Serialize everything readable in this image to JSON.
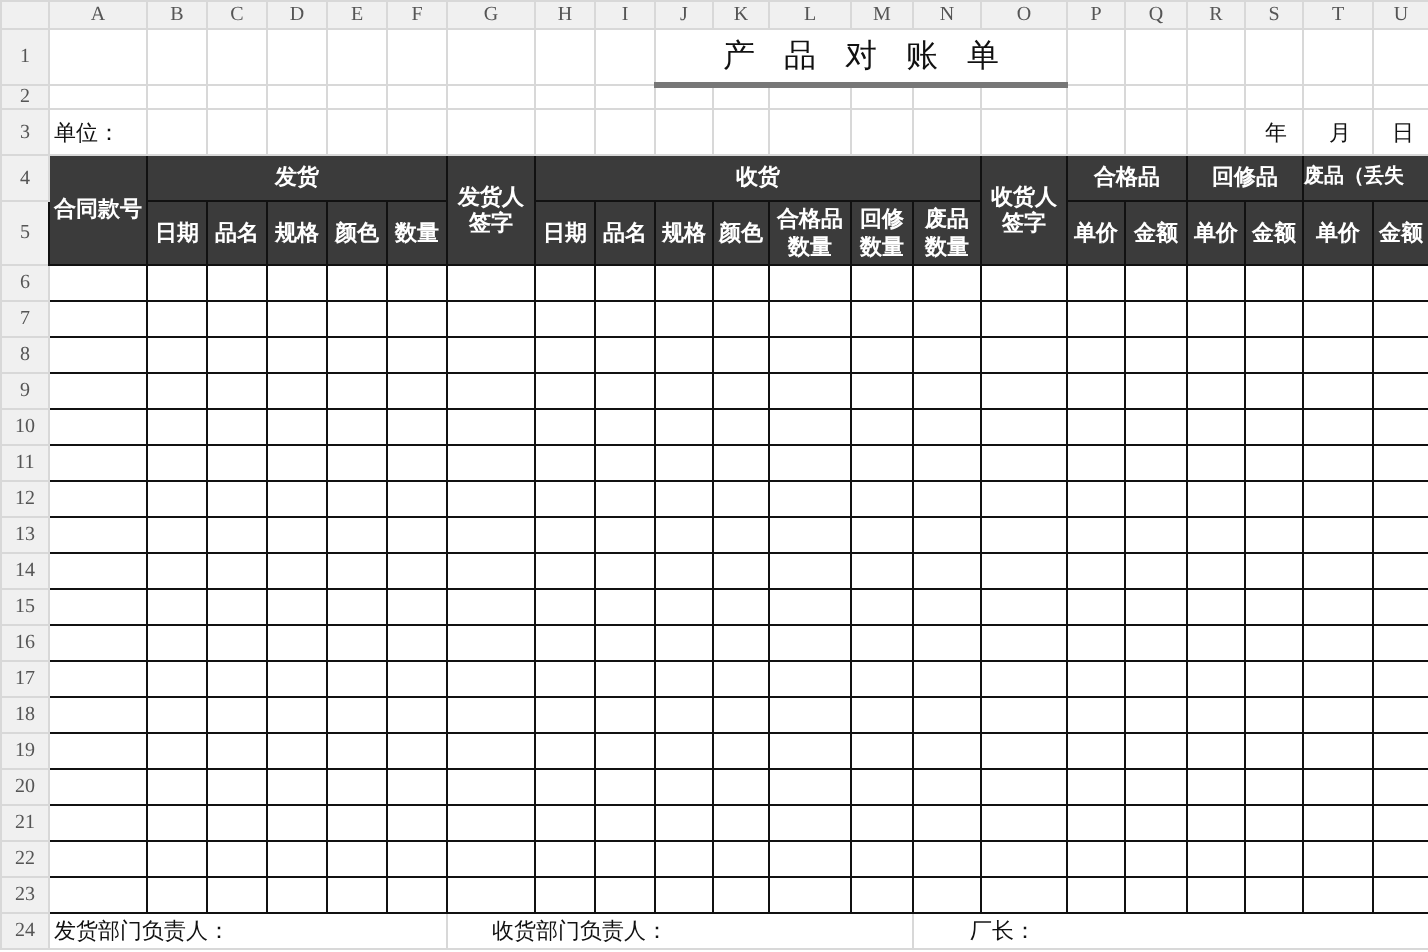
{
  "column_headers": [
    "A",
    "B",
    "C",
    "D",
    "E",
    "F",
    "G",
    "H",
    "I",
    "J",
    "K",
    "L",
    "M",
    "N",
    "O",
    "P",
    "Q",
    "R",
    "S",
    "T",
    "U"
  ],
  "row_numbers": [
    "1",
    "2",
    "3",
    "4",
    "5",
    "6",
    "7",
    "8",
    "9",
    "10",
    "11",
    "12",
    "13",
    "14",
    "15",
    "16",
    "17",
    "18",
    "19",
    "20",
    "21",
    "22",
    "23",
    "24"
  ],
  "title": "产品对账单",
  "unit_label": "单位：",
  "date_labels": [
    "年",
    "月",
    "日"
  ],
  "header": {
    "contract_no": "合同款号",
    "shipping": {
      "label": "发货",
      "columns": [
        "日期",
        "品名",
        "规格",
        "颜色",
        "数量"
      ]
    },
    "shipper_sign": "发货人签字",
    "receiving": {
      "label": "收货",
      "columns": [
        "日期",
        "品名",
        "规格",
        "颜色",
        "合格品数量",
        "回修数量",
        "废品数量"
      ]
    },
    "receiver_sign": "收货人签字",
    "price_groups": [
      {
        "label": "合格品",
        "columns": [
          "单价",
          "金额"
        ]
      },
      {
        "label": "回修品",
        "columns": [
          "单价",
          "金额"
        ]
      },
      {
        "label": "废品（丢失",
        "columns": [
          "单价",
          "金额"
        ]
      }
    ]
  },
  "footer": [
    "发货部门负责人：",
    "收货部门负责人：",
    "厂长："
  ]
}
